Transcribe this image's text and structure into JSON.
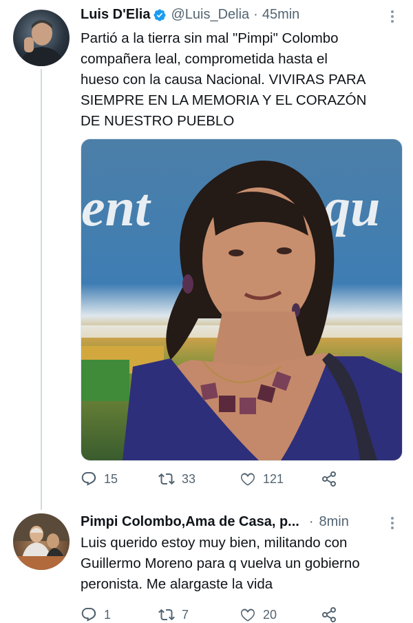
{
  "tweets": [
    {
      "display_name": "Luis D'Elia",
      "handle": "@Luis_Delia",
      "separator": "·",
      "time": "45min",
      "text": "Partió a la tierra sin mal \"Pimpi\" Colombo\ncompañera leal, comprometida hasta el\nhueso con la causa Nacional. VIVIRAS PARA\nSIEMPRE EN LA MEMORIA Y EL CORAZÓN\nDE NUESTRO PUEBLO",
      "banner_text_1": "ent",
      "banner_text_2": "qu",
      "replies": "15",
      "retweets": "33",
      "likes": "121"
    },
    {
      "display_name": "Pimpi Colombo,Ama de Casa, p...",
      "separator": "·",
      "time": "8min",
      "text": "Luis querido estoy muy bien, militando con\nGuillermo Moreno para q vuelva un gobierno\nperonista. Me alargaste la vida",
      "replies": "1",
      "retweets": "7",
      "likes": "20"
    }
  ],
  "colors": {
    "verified": "#1d9bf0",
    "secondary_text": "#536471",
    "thread_line": "#cfd9de"
  },
  "icons": [
    "verified-badge-icon",
    "more-options-icon",
    "reply-icon",
    "retweet-icon",
    "like-icon",
    "share-icon"
  ]
}
